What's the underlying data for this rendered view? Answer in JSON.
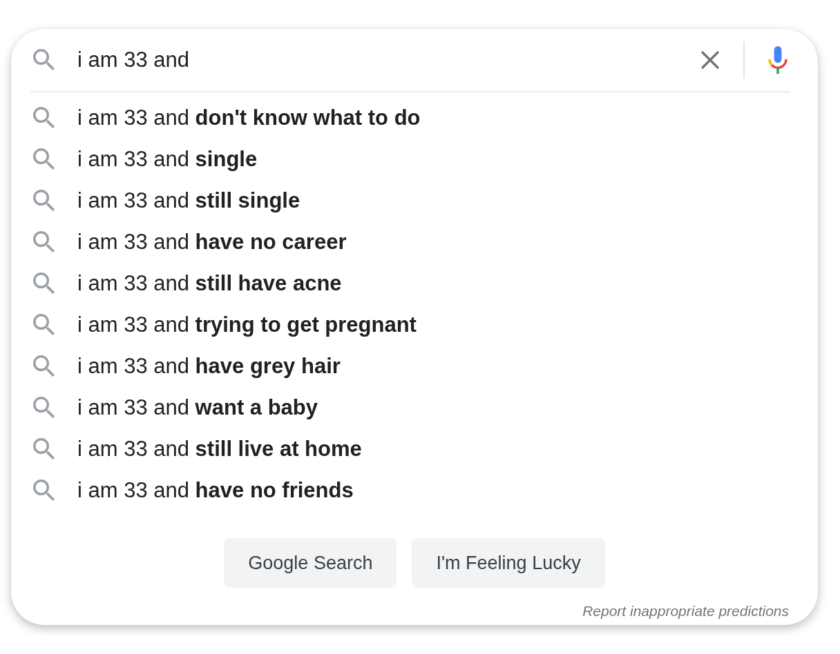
{
  "search": {
    "query": "i am 33 and"
  },
  "suggestions": [
    "i am 33 and **don't know what to do**",
    "i am 33 and **single**",
    "i am 33 and **still single**",
    "i am 33 and **have no career**",
    "i am 33 and **still have acne**",
    "i am 33 and **trying to get pregnant**",
    "i am 33 and **have grey hair**",
    "i am 33 and **want a baby**",
    "i am 33 and **still live at home**",
    "i am 33 and **have no friends**"
  ],
  "buttons": [
    {
      "label": "Google Search"
    },
    {
      "label": "I'm Feeling Lucky"
    }
  ],
  "report_link": "Report inappropriate predictions"
}
